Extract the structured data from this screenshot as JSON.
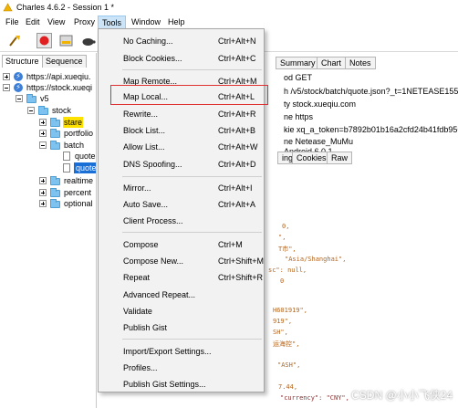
{
  "window": {
    "title": "Charles 4.6.2 - Session 1 *"
  },
  "menubar": {
    "items": [
      {
        "label": "File"
      },
      {
        "label": "Edit"
      },
      {
        "label": "View"
      },
      {
        "label": "Proxy"
      },
      {
        "label": "Tools"
      },
      {
        "label": "Window"
      },
      {
        "label": "Help"
      }
    ]
  },
  "left_panel": {
    "tabs": [
      {
        "label": "Structure"
      },
      {
        "label": "Sequence"
      }
    ],
    "tree": {
      "host1": "https://api.xueqiu.",
      "host2": "https://stock.xueqi",
      "v5": "v5",
      "stock": "stock",
      "stare": "stare",
      "portfolio": "portfolio",
      "batch": "batch",
      "quote1": "quote",
      "quote2": "quote",
      "realtime": "realtime",
      "percent": "percent",
      "optional": "optional"
    }
  },
  "right_panel": {
    "tabs": [
      {
        "label": "Summary"
      },
      {
        "label": "Chart"
      },
      {
        "label": "Notes"
      }
    ],
    "lines": [
      "od GET",
      "h /v5/stock/batch/quote.json?_t=1NETEASE155",
      "ty stock.xueqiu.com",
      "ne https",
      "kie xq_a_token=b7892b01b16a2cfd24b41fdb956",
      "ne Netease_MuMu",
      "Android 6.0.1"
    ],
    "subtabs": [
      {
        "label": "ing"
      },
      {
        "label": "Cookies"
      },
      {
        "label": "Raw"
      }
    ],
    "json_fragments": [
      "0,",
      "\",",
      "T市\",",
      "\"Asia/Shanghai\",",
      "sc\": null,",
      "0",
      "H601919\",",
      "919\",",
      "SH\",",
      "运海控\",",
      "\"ASH\",",
      "7.44,",
      "\"currency\": \"CNY\","
    ]
  },
  "tools_menu": {
    "items": [
      {
        "label": "No Caching...",
        "shortcut": "Ctrl+Alt+N"
      },
      {
        "label": "Block Cookies...",
        "shortcut": "Ctrl+Alt+C"
      },
      {
        "label": "Map Remote...",
        "shortcut": "Ctrl+Alt+M"
      },
      {
        "label": "Map Local...",
        "shortcut": "Ctrl+Alt+L"
      },
      {
        "label": "Rewrite...",
        "shortcut": "Ctrl+Alt+R"
      },
      {
        "label": "Block List...",
        "shortcut": "Ctrl+Alt+B"
      },
      {
        "label": "Allow List...",
        "shortcut": "Ctrl+Alt+W"
      },
      {
        "label": "DNS Spoofing...",
        "shortcut": "Ctrl+Alt+D"
      },
      {
        "label": "Mirror...",
        "shortcut": "Ctrl+Alt+I"
      },
      {
        "label": "Auto Save...",
        "shortcut": "Ctrl+Alt+A"
      },
      {
        "label": "Client Process...",
        "shortcut": ""
      },
      {
        "label": "Compose",
        "shortcut": "Ctrl+M"
      },
      {
        "label": "Compose New...",
        "shortcut": "Ctrl+Shift+M"
      },
      {
        "label": "Repeat",
        "shortcut": "Ctrl+Shift+R"
      },
      {
        "label": "Advanced Repeat...",
        "shortcut": ""
      },
      {
        "label": "Validate",
        "shortcut": ""
      },
      {
        "label": "Publish Gist",
        "shortcut": ""
      },
      {
        "label": "Import/Export Settings...",
        "shortcut": ""
      },
      {
        "label": "Profiles...",
        "shortcut": ""
      },
      {
        "label": "Publish Gist Settings...",
        "shortcut": ""
      }
    ]
  },
  "watermark": "CSDN @小小飞侠24",
  "colors": {
    "highlight_box": "#e03131",
    "selected": "#1a6fd6",
    "stare_highlight": "#ffe100"
  }
}
